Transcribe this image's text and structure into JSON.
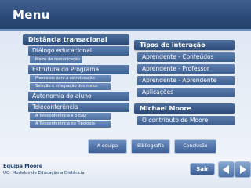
{
  "header": {
    "title": "Menu"
  },
  "left_panel": {
    "heading": "Distância transacional",
    "items": [
      {
        "label": "Diálogo educacional",
        "subs": [
          "Meios de comunicação"
        ]
      },
      {
        "label": "Estrutura do Programa",
        "subs": [
          "Processos para a estruturação",
          "Seleção e integração dos meios"
        ]
      },
      {
        "label": "Autonomia do aluno",
        "subs": []
      },
      {
        "label": "Teleconferência",
        "subs": [
          "A Teleconferência e o EaD",
          "A Teleconferência na Tipologia"
        ]
      }
    ]
  },
  "right_panel": {
    "heading": "Tipos de interação",
    "items": [
      "Aprendente - Conteúdos",
      "Aprendente - Professor",
      "Aprendente - Aprendente",
      "Aplicações"
    ],
    "section2_heading": "Michael Moore",
    "section2_items": [
      "O contributo de Moore"
    ]
  },
  "bottom_buttons": [
    "A equipa",
    "Bibliografia",
    "Conclusão"
  ],
  "footer": {
    "team": "Equipa Moore",
    "course": "UC: Modelos de Educação a Distância",
    "exit_label": "Sair",
    "prev_icon": "arrow-left-icon",
    "next_icon": "arrow-right-icon"
  }
}
